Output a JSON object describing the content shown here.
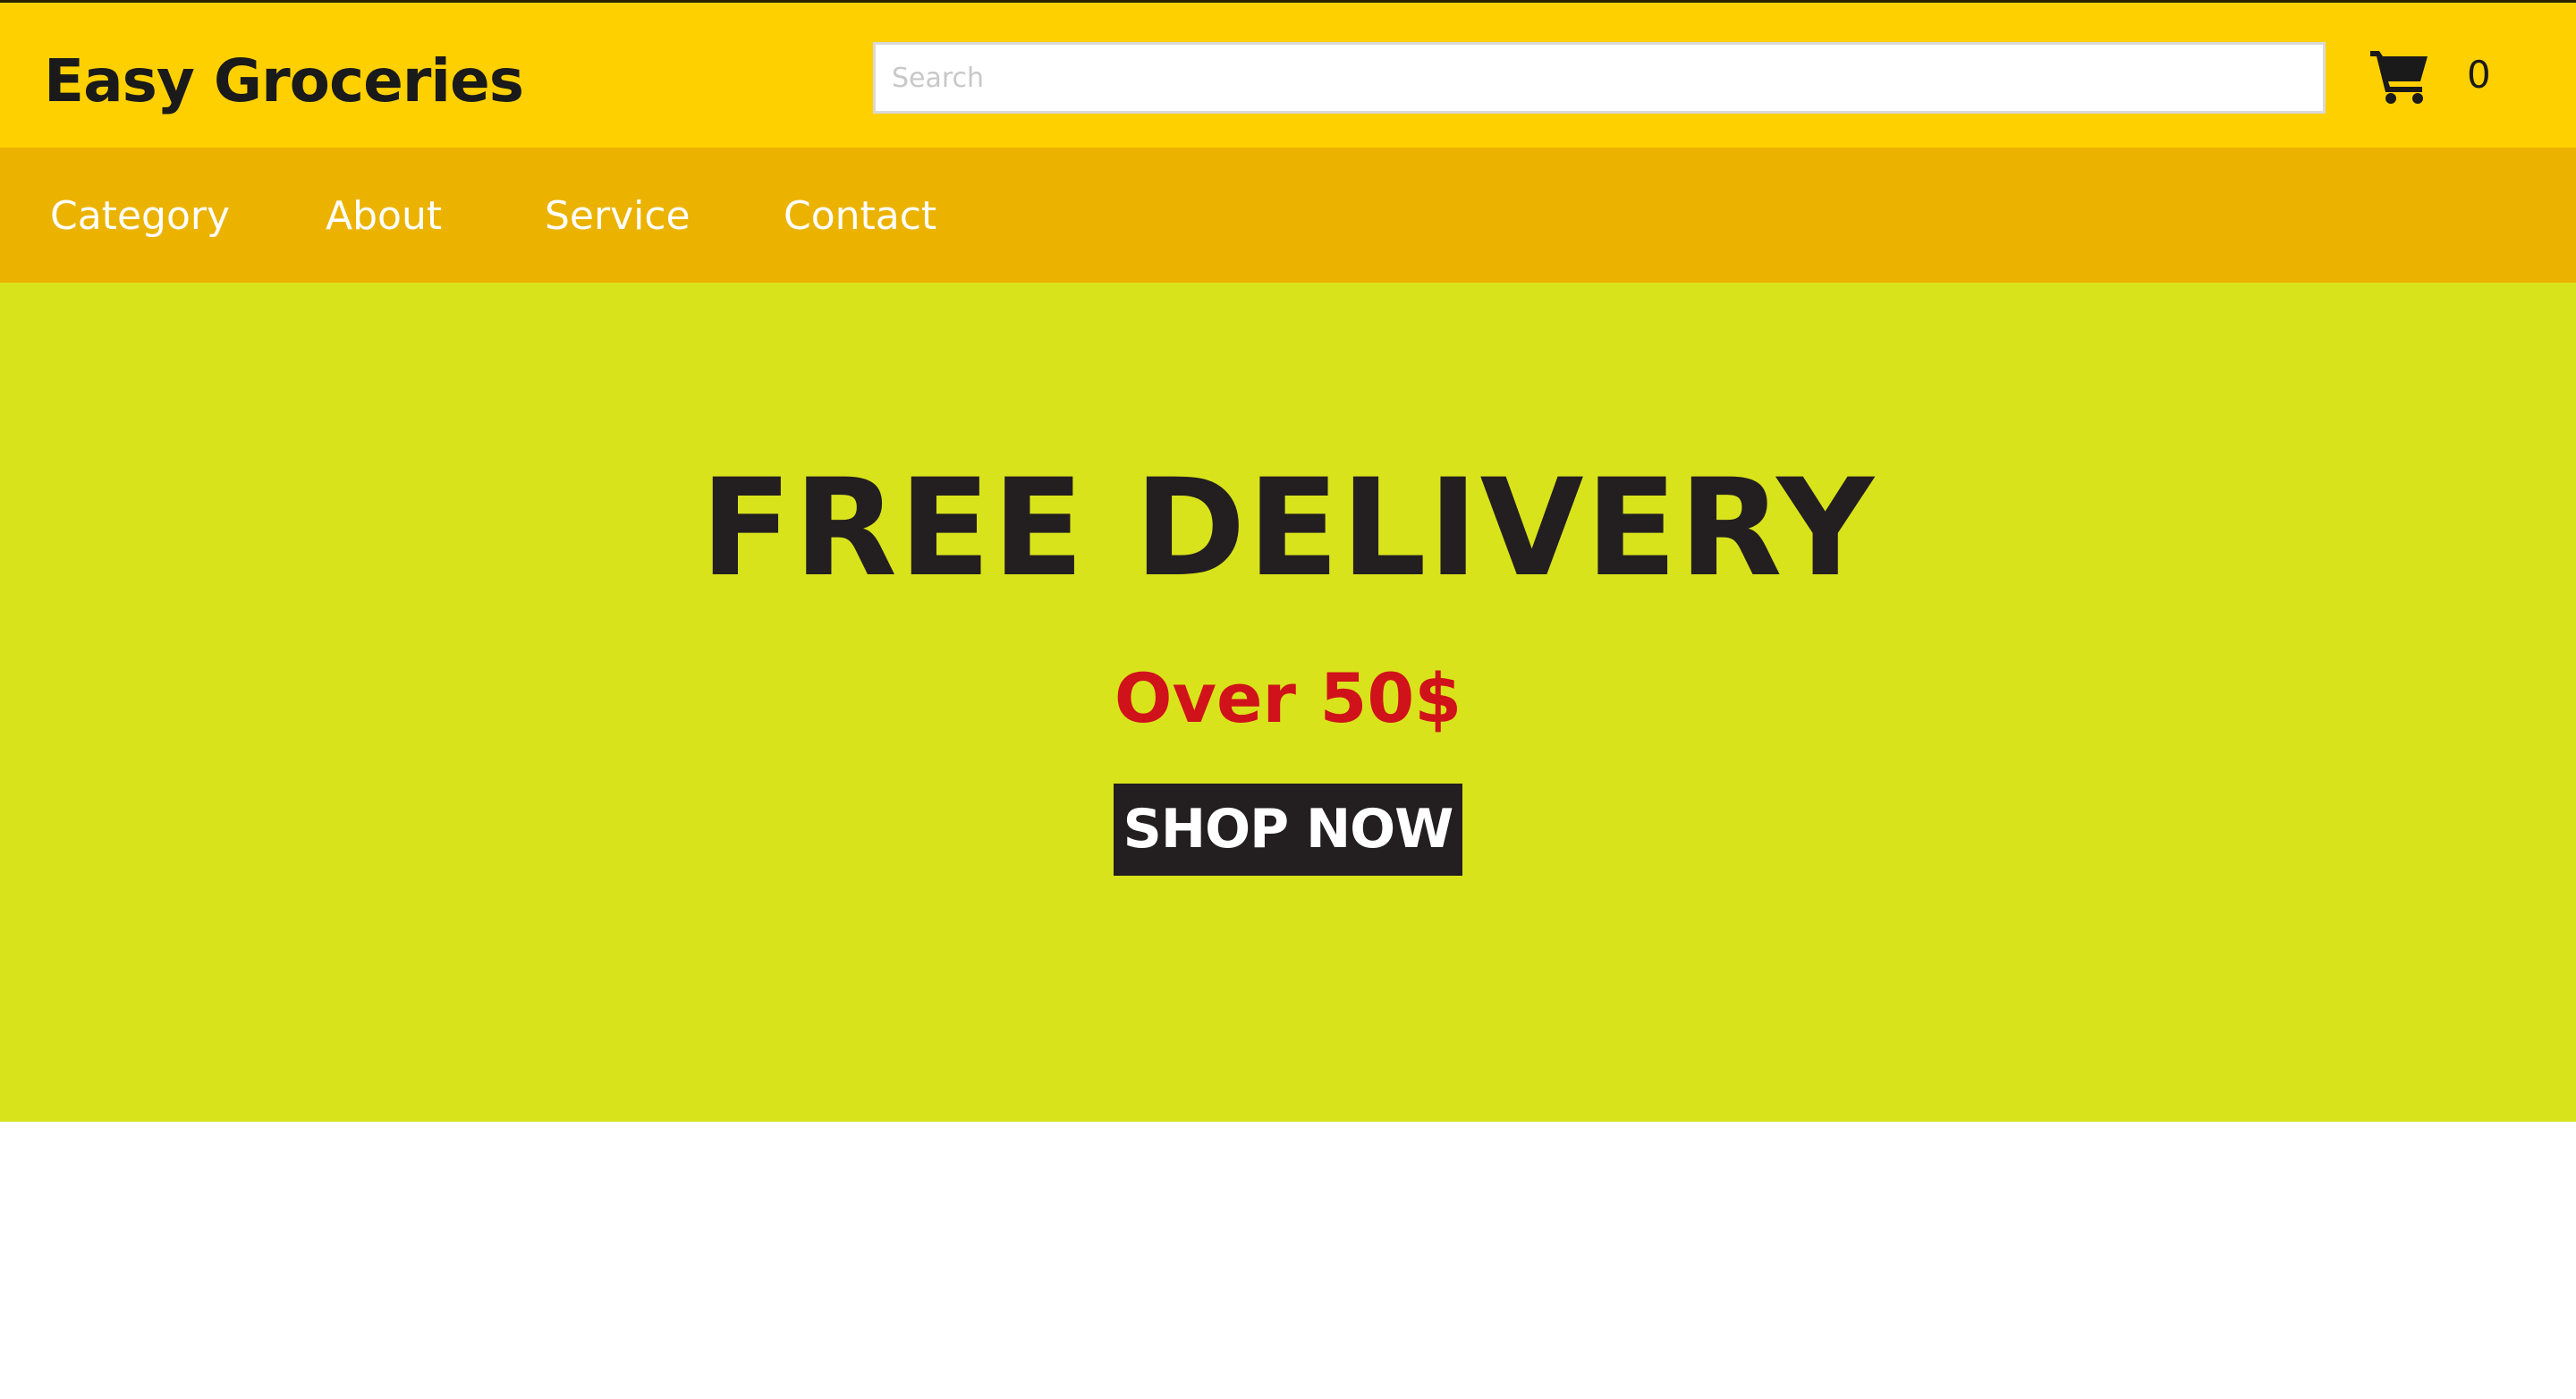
{
  "header": {
    "brand": "Easy Groceries",
    "search": {
      "placeholder": "Search",
      "value": ""
    },
    "cart": {
      "icon": "shopping-cart-icon",
      "count": "0"
    }
  },
  "nav": {
    "items": [
      {
        "label": "Category"
      },
      {
        "label": "About"
      },
      {
        "label": "Service"
      },
      {
        "label": "Contact"
      }
    ]
  },
  "hero": {
    "title": "FREE DELIVERY",
    "subtitle": "Over 50$",
    "cta_label": "SHOP NOW"
  },
  "colors": {
    "header_bg": "#ffd000",
    "nav_bg": "#ebb300",
    "hero_bg": "#d9e31c",
    "title_text": "#231f20",
    "subtitle_text": "#d0121a",
    "button_bg": "#231f20"
  }
}
